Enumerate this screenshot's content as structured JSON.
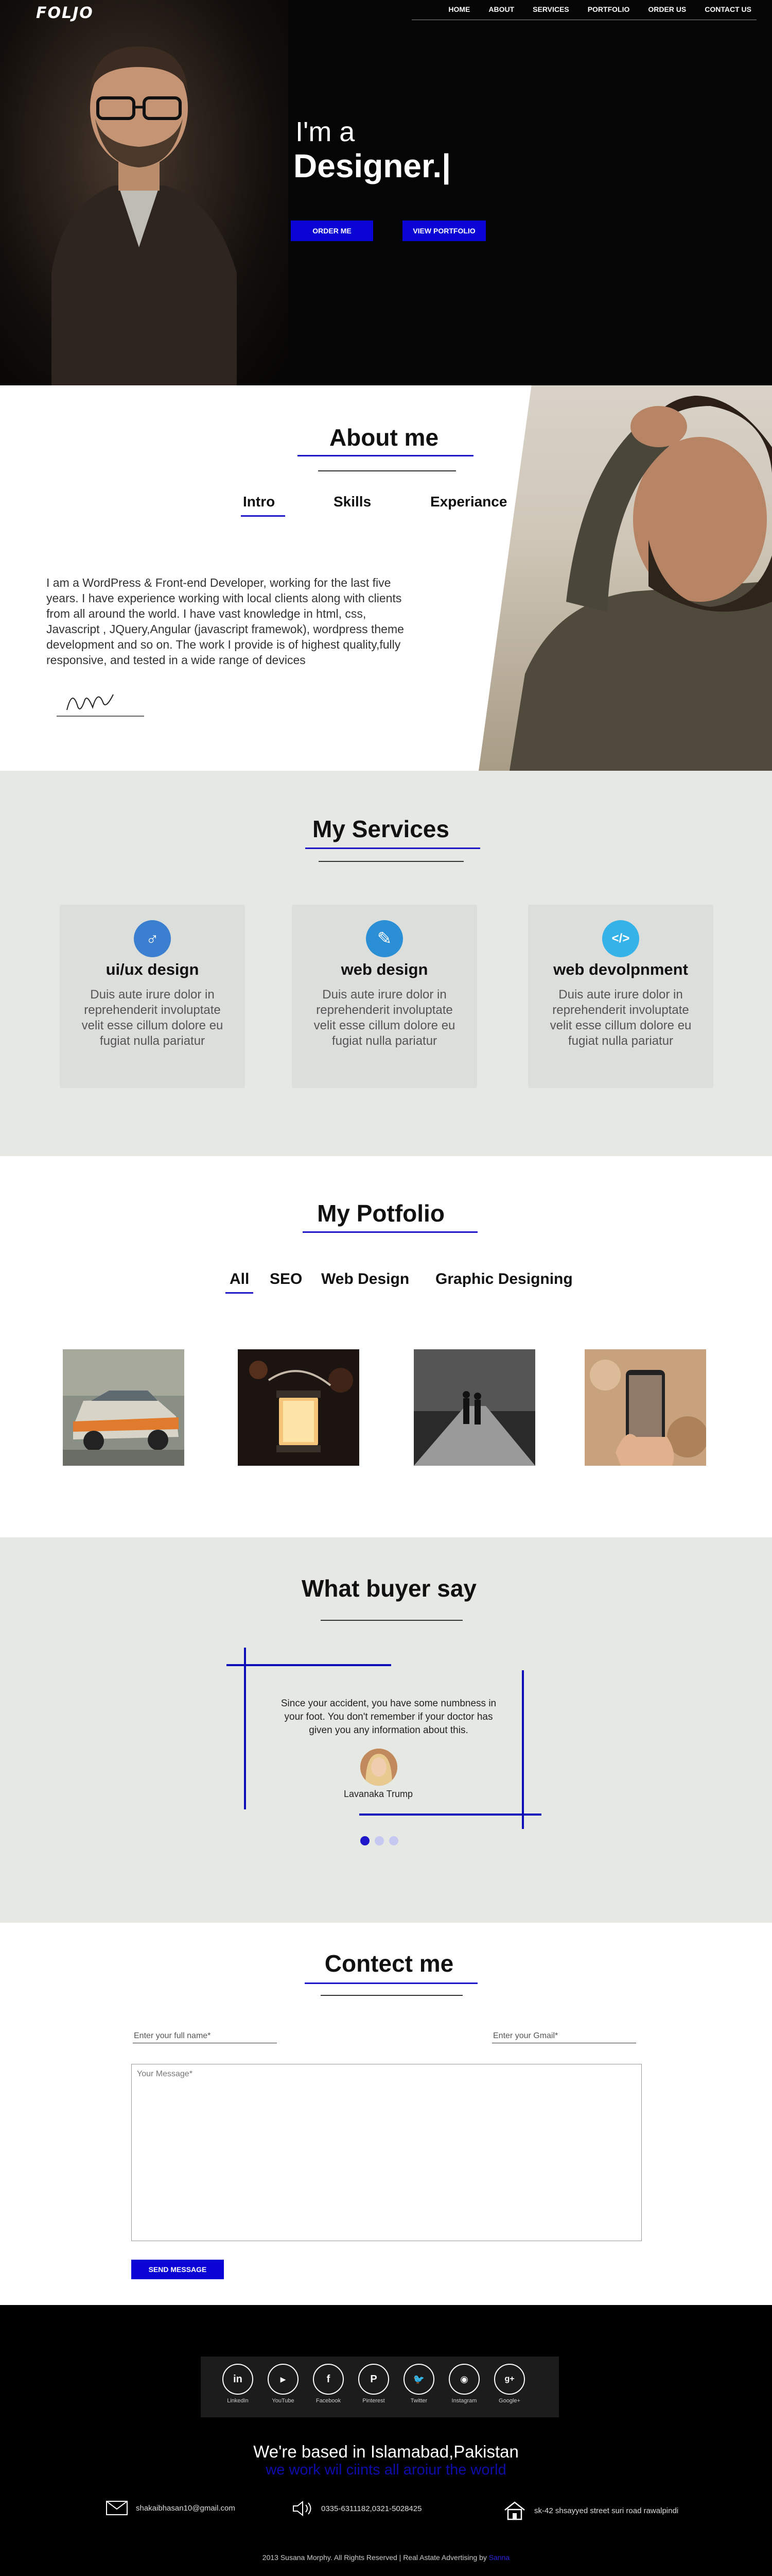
{
  "colors": {
    "accent": "#0a05d4",
    "section_bg": "#e6e8e4",
    "dark": "#000000"
  },
  "header": {
    "logo": "FOLJO",
    "nav": [
      "HOME",
      "ABOUT",
      "SERVICES",
      "PORTFOLIO",
      "ORDER US",
      "CONTACT US"
    ]
  },
  "hero": {
    "pre_title": "I'm a",
    "title": "Designer.|",
    "order_button": "ORDER ME",
    "portfolio_button": "VIEW PORTFOLIO"
  },
  "about": {
    "title": "About me",
    "tabs": [
      "Intro",
      "Skills",
      "Experiance"
    ],
    "active_tab": "Intro",
    "text": "I am a WordPress & Front-end Developer, working for the last five years. I have experience working with local clients along with clients from all around the world. I have vast knowledge in html, css, Javascript , JQuery,Angular (javascript framewok), wordpress theme development and so on. The work I provide is of highest quality,fully responsive, and tested in a wide range of devices"
  },
  "services": {
    "title": "My Services",
    "cards": [
      {
        "icon": "male-symbol-icon",
        "glyph": "♂",
        "color": "#3a7fd0",
        "title": "ui/ux design",
        "text": "Duis aute irure dolor in reprehenderit involuptate velit esse cillum dolore eu fugiat nulla pariatur"
      },
      {
        "icon": "brush-icon",
        "glyph": "✎",
        "color": "#2b8fd6",
        "title": "web design",
        "text": "Duis aute irure dolor in reprehenderit involuptate velit esse cillum dolore eu fugiat nulla pariatur"
      },
      {
        "icon": "code-icon",
        "glyph": "</>",
        "color": "#35b3e8",
        "title": "web devolpnment",
        "text": "Duis aute irure dolor in reprehenderit involuptate velit esse cillum dolore eu fugiat nulla pariatur"
      }
    ]
  },
  "portfolio": {
    "title": "My Potfolio",
    "tabs": [
      "All",
      "SEO",
      "Web Design",
      "Graphic Designing"
    ],
    "active_tab": "All",
    "images": [
      "car-photo",
      "lantern-photo",
      "couple-walking-photo",
      "phone-in-hand-photo"
    ]
  },
  "testimonials": {
    "title": "What buyer say",
    "quote": "Since your accident, you have some numbness in your foot. You don't remember if your doctor has given you any information about this.",
    "name": "Lavanaka Trump",
    "active_dot": 0,
    "dot_count": 3
  },
  "contact": {
    "title": "Contect me",
    "name_placeholder": "Enter your full name*",
    "email_placeholder": "Enter your Gmail*",
    "message_placeholder": "Your Message*",
    "send_button": "SEND MESSAGE"
  },
  "footer": {
    "social": [
      "LinkedIn",
      "YouTube",
      "Facebook",
      "Pinterest",
      "Twitter",
      "Instagram",
      "Google+"
    ],
    "based_title": "We're based in Islamabad,Pakistan",
    "based_sub": "we work wil ciints all aroiur the world",
    "email": "shakaibhasan10@gmail.com",
    "phone": "0335-6311182,0321-5028425",
    "address": "sk-42 shsayyed street suri road rawalpindi",
    "copyright": "2013 Susana Morphy. All Rights Reserved | Real Astate Advertising by",
    "copyright_brand": "Sanna"
  }
}
